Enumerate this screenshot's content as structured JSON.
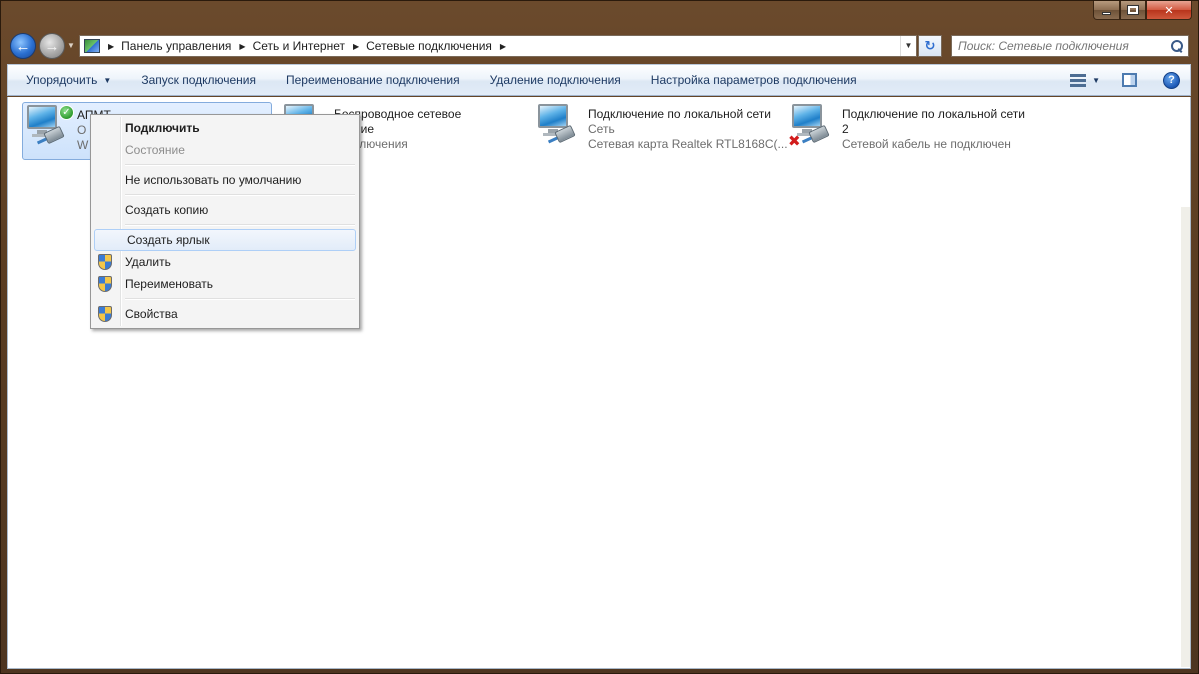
{
  "window": {
    "caption_close": "✕"
  },
  "address_bar": {
    "crumbs": [
      "Панель управления",
      "Сеть и Интернет",
      "Сетевые подключения"
    ]
  },
  "search": {
    "placeholder": "Поиск: Сетевые подключения"
  },
  "command_bar": {
    "organize": "Упорядочить",
    "start_connection": "Запуск подключения",
    "rename_connection": "Переименование подключения",
    "delete_connection": "Удаление подключения",
    "connection_settings": "Настройка параметров подключения"
  },
  "connections": [
    {
      "name": "АПМТ",
      "line2": "О",
      "line3": "W",
      "status": "connected"
    },
    {
      "name": "Беспроводное сетевое",
      "line2": "инение",
      "line3": "подключения"
    },
    {
      "name": "Подключение по локальной сети",
      "line2": "Сеть",
      "line3": "Сетевая карта Realtek RTL8168C(..."
    },
    {
      "name": "Подключение по локальной сети",
      "line2": "2",
      "line3": "Сетевой кабель не подключен",
      "status": "disconnected"
    }
  ],
  "context_menu": {
    "connect": "Подключить",
    "status": "Состояние",
    "not_default": "Не использовать по умолчанию",
    "create_copy": "Создать копию",
    "create_shortcut": "Создать ярлык",
    "delete": "Удалить",
    "rename": "Переименовать",
    "properties": "Свойства"
  },
  "colors": {
    "frame": "#5a3d22",
    "command_text": "#1e3a63",
    "hover_border": "#aecff7"
  }
}
